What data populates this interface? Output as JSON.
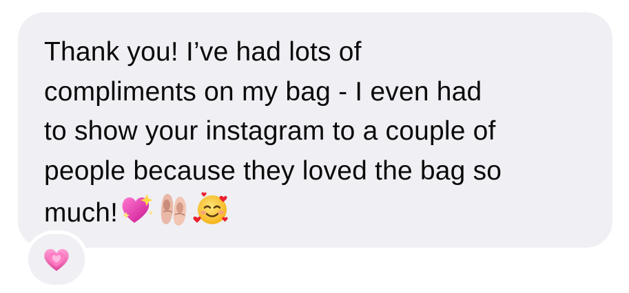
{
  "message": {
    "lines": [
      "Thank you! I’ve had lots of",
      "compliments on my bag - I even had",
      "to show your instagram to a couple of",
      "people because they loved the bag so",
      "much!"
    ],
    "emojis": [
      "sparkling-heart-emoji",
      "ballet-shoes-emoji",
      "smiling-face-with-hearts-emoji"
    ]
  },
  "reaction": {
    "emoji": "growing-heart-emoji"
  },
  "colors": {
    "bubble": "#efeff4",
    "text": "#0a0a0a",
    "background": "#ffffff"
  }
}
